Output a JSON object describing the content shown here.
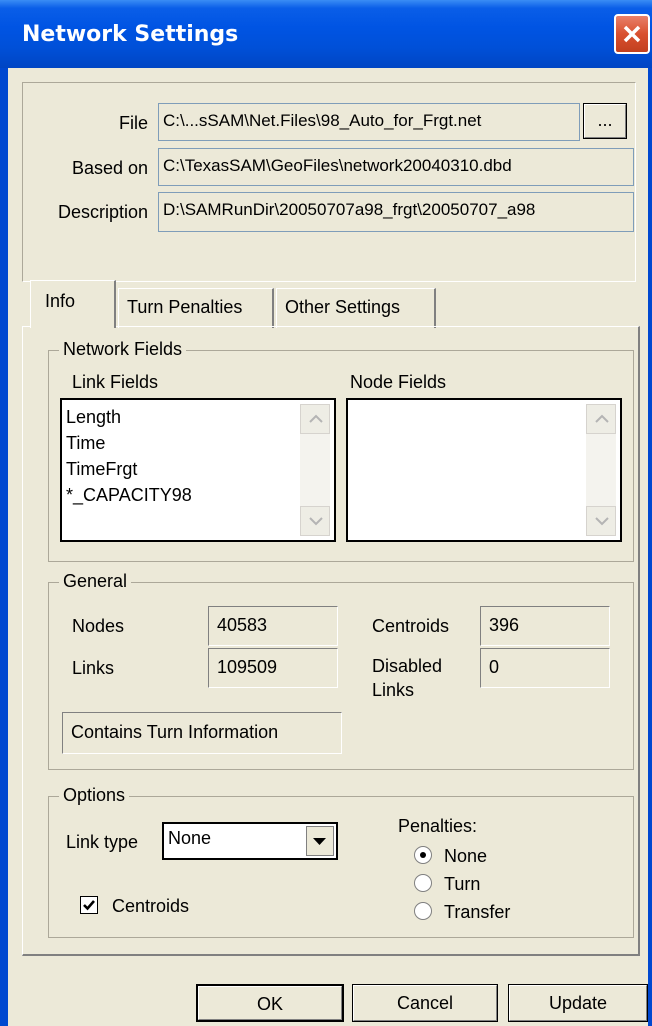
{
  "window": {
    "title": "Network Settings"
  },
  "file_section": {
    "file_label": "File",
    "file_value": "C:\\...sSAM\\Net.Files\\98_Auto_for_Frgt.net",
    "browse_label": "...",
    "based_on_label": "Based on",
    "based_on_value": "C:\\TexasSAM\\GeoFiles\\network20040310.dbd",
    "description_label": "Description",
    "description_value": "D:\\SAMRunDir\\20050707a98_frgt\\20050707_a98"
  },
  "tabs": [
    {
      "label": "Info",
      "active": true
    },
    {
      "label": "Turn Penalties",
      "active": false
    },
    {
      "label": "Other Settings",
      "active": false
    }
  ],
  "network_fields": {
    "legend": "Network Fields",
    "link_fields_label": "Link Fields",
    "link_fields": [
      "Length",
      "Time",
      "TimeFrgt",
      "*_CAPACITY98"
    ],
    "node_fields_label": "Node Fields",
    "node_fields": []
  },
  "general": {
    "legend": "General",
    "nodes_label": "Nodes",
    "nodes_value": "40583",
    "links_label": "Links",
    "links_value": "109509",
    "centroids_label": "Centroids",
    "centroids_value": "396",
    "disabled_links_label_1": "Disabled",
    "disabled_links_label_2": "Links",
    "disabled_links_value": "0",
    "turn_info": "Contains Turn Information"
  },
  "options": {
    "legend": "Options",
    "link_type_label": "Link type",
    "link_type_value": "None",
    "centroids_label": "Centroids",
    "centroids_checked": true,
    "penalties_label": "Penalties:",
    "penalty_options": [
      "None",
      "Turn",
      "Transfer"
    ],
    "penalty_selected": "None"
  },
  "buttons": {
    "ok": "OK",
    "cancel": "Cancel",
    "update": "Update"
  }
}
